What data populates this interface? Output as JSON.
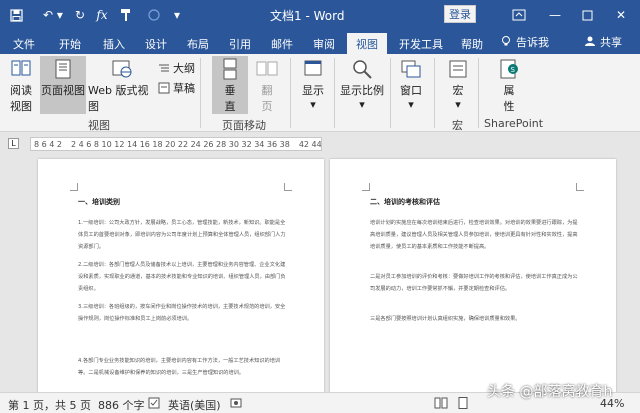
{
  "window": {
    "title": "文档1 - Word",
    "login_label": "登录"
  },
  "tabs": [
    "文件",
    "开始",
    "插入",
    "设计",
    "布局",
    "引用",
    "邮件",
    "审阅",
    "视图",
    "开发工具",
    "帮助"
  ],
  "active_tab": "视图",
  "tell_me": "告诉我",
  "share": "共享",
  "ribbon": {
    "read_view": [
      "阅读",
      "视图"
    ],
    "page_view": "页面视图",
    "web_view": "Web 版式视图",
    "outline": "大纲",
    "draft": "草稿",
    "views_group": "视图",
    "vertical": [
      "垂",
      "直"
    ],
    "side_by_side": [
      "翻",
      "页"
    ],
    "page_move_group": "页面移动",
    "show": "显示",
    "zoom": "显示比例",
    "window_btn": "窗口",
    "macros": "宏",
    "macros_group": "宏",
    "properties": [
      "属",
      "性"
    ],
    "sharepoint_group": "SharePoint"
  },
  "ruler": {
    "left_marks": "8 6 4 2",
    "right_marks": "2 4 6 8 10 12 14 16 18 20 22 24 26 28 30 32 34 36 38",
    "end_marks": "42 44 46 48"
  },
  "pages": [
    {
      "heading": "一、培训类别",
      "paragraphs": [
        "1.一级培训：公司大政方针，发展战略，员工心态，管理技能，新技术，新知识。职能是全体员工的首要培训对象，即培训内容为公司年度计划上预算和全体管理人员，组织部门人力资源部门。",
        "2.二级培训：各部门管理人员及储备技术以上培训，主要管理和业务内容管理、企业文化建设和素质，实现职业的通道，基本的技术技能和专业知识的培训、组织管理人员，由部门负责组织。",
        "3.三级培训：各班组级的，按车间作业和岗位操作技术的培训，主要技术规范的培训，安全操作规则，岗位操作标准和员工上岗前必须培训。",
        "4.各部门专业业务技能知识的培训，主要培训内容有工作方法，一般工艺技术知识的培训等。二是机械设备维护和保养的知识的培训，三是生产管理知识的培训。"
      ]
    },
    {
      "heading": "二、培训的考核和评估",
      "paragraphs": [
        "培训计划的实施应在每次培训结束后进行，检查培训效果。对培训的效果要进行跟踪，为提高培训质量，建议管理人员及相关管理人员参加培训，使培训更具有针对性和实效性，提高培训质量，使员工的基本素质和工作技能不断提高。",
        "二是对员工参加培训的评价和考核：要做好培训工作的考核和评估，使培训工作真正成为公司发展的动力，培训工作要常抓不懈，并要定期检查和评估。",
        "三是各部门要按照培训计划认真组织实施，确保培训质量和效果。"
      ]
    }
  ],
  "status": {
    "page": "第 1 页，共 5 页",
    "words": "886 个字",
    "language": "英语(美国)",
    "zoom": "44%"
  },
  "watermark": "头条 @部落窝教育h"
}
